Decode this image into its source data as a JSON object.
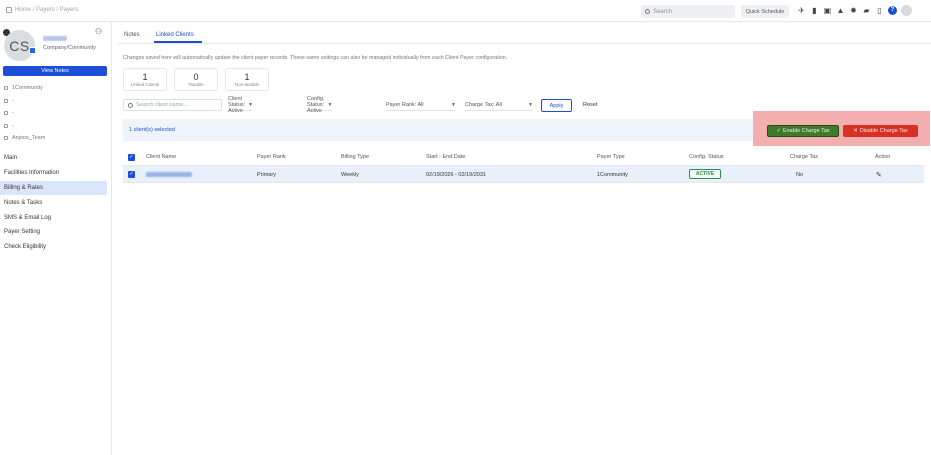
{
  "topbar": {
    "breadcrumb": "Home / Payers / Payers",
    "search_placeholder": "Search",
    "quick_schedule": "Quick Schedule",
    "help_label": "?"
  },
  "sidebar": {
    "avatar_initials": "CS",
    "payer_type": "Company/Community",
    "view_notes": "View Notes",
    "info_items": [
      "1Community",
      "-",
      "-",
      "-",
      "Anjoos_Team"
    ],
    "nav": [
      {
        "label": "Main",
        "active": false
      },
      {
        "label": "Facilities Information",
        "active": false
      },
      {
        "label": "Billing & Rates",
        "active": true
      },
      {
        "label": "Notes & Tasks",
        "active": false
      },
      {
        "label": "SMS & Email Log",
        "active": false
      },
      {
        "label": "Payer Setting",
        "active": false
      },
      {
        "label": "Check Eligibility",
        "active": false
      }
    ]
  },
  "tabs": [
    {
      "label": "Notes",
      "active": false
    },
    {
      "label": "Linked Clients",
      "active": true
    }
  ],
  "hint": "Changes saved here will automatically update the client payer records. These same settings can also be managed individually from each Client Payer configuration.",
  "stats": [
    {
      "value": "1",
      "label": "Linked Clients"
    },
    {
      "value": "0",
      "label": "Taxable"
    },
    {
      "value": "1",
      "label": "Non-taxable"
    }
  ],
  "filters": {
    "search_placeholder": "Search client name...",
    "client_status": "Client Status: Active",
    "config_status": "Config. Status: Active",
    "payer_rank": "Payer Rank: All",
    "charge_tax": "Charge Tax: All",
    "apply": "Apply",
    "reset": "Reset"
  },
  "selection": {
    "text": "1 client(s) selected",
    "enable": "Enable Charge Tax",
    "disable": "Disable Charge Tax"
  },
  "table": {
    "columns": [
      "Client Name",
      "Payer Rank",
      "Billing Type",
      "Start - End Date",
      "Payer Type",
      "Config. Status",
      "Charge Tax",
      "Action"
    ],
    "rows": [
      {
        "payer_rank": "Primary",
        "billing_type": "Weekly",
        "dates": "02/19/2026 - 02/19/2031",
        "payer_type": "1Community",
        "status": "ACTIVE",
        "charge_tax": "No"
      }
    ]
  },
  "colors": {
    "accent": "#1d4ed8",
    "enable": "#3d7a2a",
    "disable": "#d93025",
    "highlight": "#f3a7a8"
  }
}
